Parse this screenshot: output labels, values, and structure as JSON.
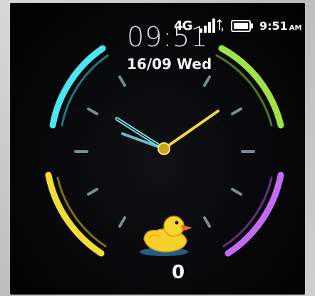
{
  "status_bar": {
    "network": "4G",
    "time": "9:51",
    "ampm": "AM",
    "icons": [
      "signal-icon",
      "battery-icon"
    ]
  },
  "watch_face": {
    "digital_time": "09:51",
    "date": "16/09 Wed",
    "step_count": "0",
    "analog_time": {
      "hour": 9,
      "minute": 51
    },
    "arc_colors": {
      "top_left": "#4ee6f0",
      "top_right": "#9fe34a",
      "bottom_left": "#f2dd36",
      "bottom_right": "#c46af5"
    },
    "hand_colors": {
      "hour": "#7fe8ee",
      "minute": "#f3d63a"
    },
    "mascot": "rubber-duck-icon"
  }
}
